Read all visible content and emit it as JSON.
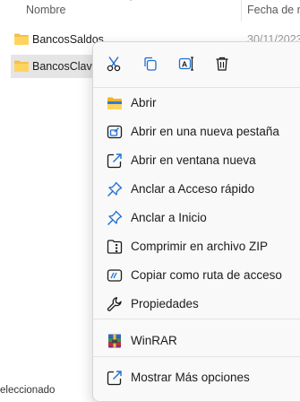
{
  "columns": {
    "name": "Nombre",
    "date": "Fecha de m"
  },
  "files": [
    {
      "name": "BancosSaldos",
      "date": "30/11/2023"
    },
    {
      "name": "BancosClave",
      "date": ""
    }
  ],
  "status_bar": {
    "text": "eleccionado"
  },
  "context_menu": {
    "quick_actions": [
      {
        "icon": "scissors-icon",
        "action": "cut"
      },
      {
        "icon": "copy-icon",
        "action": "copy"
      },
      {
        "icon": "rename-icon",
        "action": "rename"
      },
      {
        "icon": "trash-icon",
        "action": "delete"
      }
    ],
    "items": [
      {
        "label": "Abrir",
        "icon": "folder-open-icon"
      },
      {
        "label": "Abrir en una nueva pestaña",
        "icon": "new-tab-icon"
      },
      {
        "label": "Abrir en ventana nueva",
        "icon": "new-window-icon"
      },
      {
        "label": "Anclar a Acceso rápido",
        "icon": "pin-icon"
      },
      {
        "label": "Anclar a Inicio",
        "icon": "pin-start-icon"
      },
      {
        "label": "Comprimir en archivo ZIP",
        "icon": "zip-icon"
      },
      {
        "label": "Copiar como ruta de acceso",
        "icon": "copy-path-icon"
      },
      {
        "label": "Propiedades",
        "icon": "wrench-icon"
      },
      {
        "label": "WinRAR",
        "icon": "winrar-icon"
      },
      {
        "label": "Mostrar Más opciones",
        "icon": "more-options-icon"
      }
    ],
    "accent_color": "#1f6fd6"
  }
}
